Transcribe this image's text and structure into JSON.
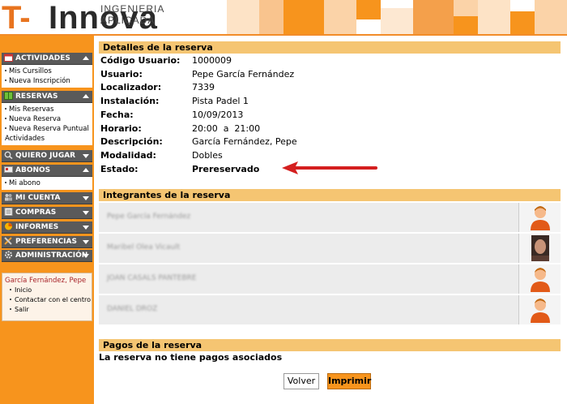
{
  "header": {
    "logo_t": "T-",
    "logo_rest": "Innova",
    "logo_sub": "INGENIERIA APLICADA",
    "accent": "#f28c28"
  },
  "sidebar": {
    "sections": [
      {
        "title": "ACTIVIDADES",
        "icon": "calendar-icon",
        "items": [
          "Mis Cursillos",
          "Nueva Inscripción"
        ]
      },
      {
        "title": "RESERVAS",
        "icon": "book-icon",
        "items": [
          "Mis Reservas",
          "Nueva Reserva",
          "Nueva Reserva Puntual Actividades"
        ]
      },
      {
        "title": "QUIERO JUGAR",
        "icon": "search-icon",
        "items": []
      },
      {
        "title": "ABONOS",
        "icon": "card-icon",
        "items": [
          "Mi abono"
        ]
      },
      {
        "title": "MI CUENTA",
        "icon": "people-icon",
        "items": []
      },
      {
        "title": "COMPRAS",
        "icon": "list-icon",
        "items": []
      },
      {
        "title": "INFORMES",
        "icon": "chart-icon",
        "items": []
      },
      {
        "title": "PREFERENCIAS",
        "icon": "tools-icon",
        "items": []
      },
      {
        "title": "ADMINISTRACIÓN",
        "icon": "gear-icon",
        "items": []
      }
    ],
    "user": {
      "name": "García Fernández, Pepe",
      "links": [
        "Inicio",
        "Contactar con el centro",
        "Salir"
      ]
    }
  },
  "main": {
    "details": {
      "title": "Detalles de la reserva",
      "rows": [
        {
          "label": "Código Usuario:",
          "value": "1000009"
        },
        {
          "label": "Usuario:",
          "value": "Pepe García Fernández"
        },
        {
          "label": "Localizador:",
          "value": "7339"
        },
        {
          "label": "Instalación:",
          "value": "Pista Padel 1"
        },
        {
          "label": "Fecha:",
          "value": "10/09/2013"
        },
        {
          "label": "Horario:",
          "value": "20:00  a  21:00"
        },
        {
          "label": "Descripción:",
          "value": "García Fernández, Pepe"
        },
        {
          "label": "Modalidad:",
          "value": "Dobles"
        },
        {
          "label": "Estado:",
          "value": "Prereservado"
        }
      ]
    },
    "integrantes": {
      "title": "Integrantes de la reserva",
      "rows": [
        {
          "name": "Pepe García Fernández",
          "avatar": "default-avatar-icon"
        },
        {
          "name": "Maribel Olea Vicault",
          "avatar": "photo-avatar"
        },
        {
          "name": "JOAN CASALS PANTEBRE",
          "avatar": "default-avatar-icon"
        },
        {
          "name": "DANIEL DROZ",
          "avatar": "default-avatar-icon"
        }
      ]
    },
    "pagos": {
      "title": "Pagos de la reserva",
      "empty_message": "La reserva no tiene pagos asociados"
    },
    "buttons": {
      "volver": "Volver",
      "imprimir": "Imprimir"
    }
  }
}
